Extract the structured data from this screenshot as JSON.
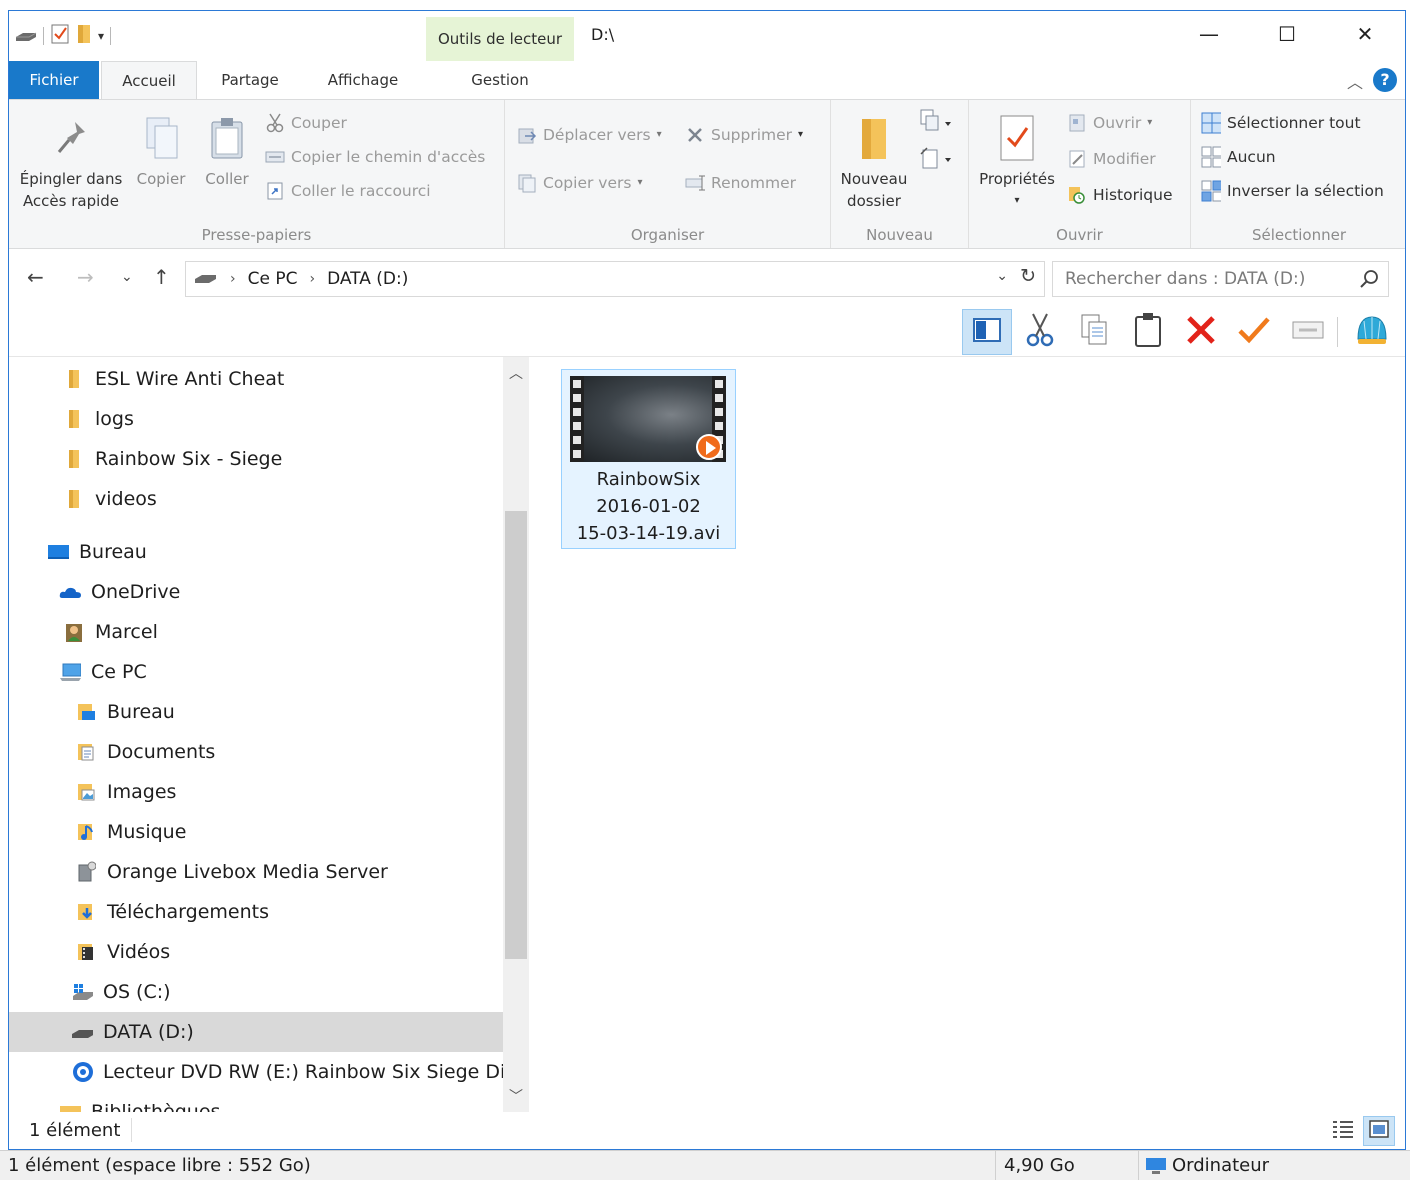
{
  "title": {
    "contextual_tab": "Outils de lecteur",
    "path": "D:\\",
    "minimize_glyph": "—",
    "maximize_glyph": "☐",
    "close_glyph": "✕"
  },
  "tabs": {
    "file": "Fichier",
    "home": "Accueil",
    "share": "Partage",
    "view": "Affichage",
    "manage": "Gestion",
    "collapse_glyph": "︿",
    "help_glyph": "?"
  },
  "ribbon": {
    "clipboard": {
      "pin_line1": "Épingler dans",
      "pin_line2": "Accès rapide",
      "copy": "Copier",
      "paste": "Coller",
      "cut": "Couper",
      "copy_path": "Copier le chemin d'accès",
      "paste_shortcut": "Coller le raccourci",
      "label": "Presse-papiers"
    },
    "organize": {
      "move_to": "Déplacer vers",
      "copy_to": "Copier vers",
      "delete": "Supprimer",
      "rename": "Renommer",
      "label": "Organiser"
    },
    "new": {
      "new_folder_line1": "Nouveau",
      "new_folder_line2": "dossier",
      "label": "Nouveau"
    },
    "open": {
      "properties": "Propriétés",
      "open": "Ouvrir",
      "edit": "Modifier",
      "history": "Historique",
      "label": "Ouvrir"
    },
    "select": {
      "select_all": "Sélectionner tout",
      "select_none": "Aucun",
      "invert": "Inverser la sélection",
      "label": "Sélectionner"
    }
  },
  "address": {
    "crumbs": [
      "Ce PC",
      "DATA (D:)"
    ],
    "search_placeholder": "Rechercher dans : DATA (D:)"
  },
  "nav_tree": [
    {
      "label": "ESL Wire Anti Cheat",
      "icon": "folder-icon"
    },
    {
      "label": "logs",
      "icon": "folder-icon"
    },
    {
      "label": "Rainbow Six - Siege",
      "icon": "folder-icon"
    },
    {
      "label": "videos",
      "icon": "folder-icon"
    },
    {
      "label": "Bureau",
      "icon": "desktop-icon"
    },
    {
      "label": "OneDrive",
      "icon": "onedrive-icon"
    },
    {
      "label": "Marcel",
      "icon": "user-icon"
    },
    {
      "label": "Ce PC",
      "icon": "computer-icon"
    },
    {
      "label": "Bureau",
      "icon": "desktop-folder-icon"
    },
    {
      "label": "Documents",
      "icon": "documents-icon"
    },
    {
      "label": "Images",
      "icon": "images-icon"
    },
    {
      "label": "Musique",
      "icon": "music-icon"
    },
    {
      "label": "Orange Livebox Media Server",
      "icon": "media-server-icon"
    },
    {
      "label": "Téléchargements",
      "icon": "downloads-icon"
    },
    {
      "label": "Vidéos",
      "icon": "videos-icon"
    },
    {
      "label": "OS (C:)",
      "icon": "windows-drive-icon"
    },
    {
      "label": "DATA (D:)",
      "icon": "drive-icon"
    },
    {
      "label": "Lecteur DVD RW (E:) Rainbow Six Siege Disc",
      "icon": "dvd-icon"
    },
    {
      "label": "Bibliothèques",
      "icon": "libraries-icon"
    }
  ],
  "file": {
    "name_line1": "RainbowSix",
    "name_line2": "2016-01-02",
    "name_line3": "15-03-14-19.avi"
  },
  "status": {
    "count": "1 élément",
    "summary": "1 élément (espace libre : 552 Go)",
    "size": "4,90 Go",
    "location": "Ordinateur"
  },
  "colors": {
    "accent": "#1979ca",
    "contextual_tab": "#e6f4d6",
    "selection_bg": "#e5f3ff",
    "folder": "#f4c35a"
  }
}
